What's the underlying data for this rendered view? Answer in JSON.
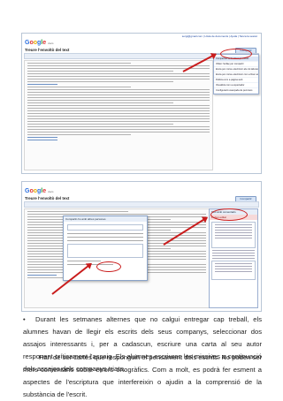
{
  "screenshot1": {
    "logo": [
      "G",
      "o",
      "o",
      "g",
      "l",
      "e"
    ],
    "logo_sub": "docs",
    "doc_title": "Treure l'envoltò del text",
    "share_label": "Compartir",
    "top_links": "sergi@gmail.com | Llista de documents | Ajuda | Tanca la sessió",
    "menu_items": [
      "Comparteix amb altres persones",
      "Obtén l'enllaç per compartir",
      "Envia per correu electrònic als col·laboradors",
      "Envia per correu electrònic com a fitxer adjunt",
      "Publica com a pàgina web",
      "Visualitza com a espectador",
      "Configuració avançada de permisos"
    ]
  },
  "screenshot2": {
    "logo": [
      "G",
      "o",
      "o",
      "g",
      "l",
      "e"
    ],
    "logo_sub": "docs",
    "doc_title": "Treure l'envoltò del text",
    "share_label": "Compartir",
    "dialog_title": "Compartir-ho amb altres persones",
    "panel_title": "Text amb comentaris",
    "panel_highlight": "Poden editar",
    "panel_items": [
      "Mostra l'historial",
      "Afegeix un comentari",
      "Resol",
      "Veure historial"
    ]
  },
  "paragraph1": "Durant les setmanes alternes que no calgui entregar cap treball, els alumnes havan de llegir els escrits dels seus companys, seleccionar dos assajos interessants i, per a cadascun, escriure una carta al seu autor responent críticament l'assaig. Els alumnes escriuran les missives a continuació dels assajos dels companys triats.",
  "paragraph2": "Han de ser cartes que responguin el pensament dels escrits. No poden ser mers comentaris sobre errors ortogràfics. Com a molt, es podrà fer esment a aspectes de l'escriptura que interfereixin o ajudin a la comprensió de la substància de l'escrit.",
  "bullet_glyph": "•",
  "colors": {
    "arrow": "#c91c1c",
    "link": "#1a45a0",
    "toolbar": "#e8eef7"
  }
}
